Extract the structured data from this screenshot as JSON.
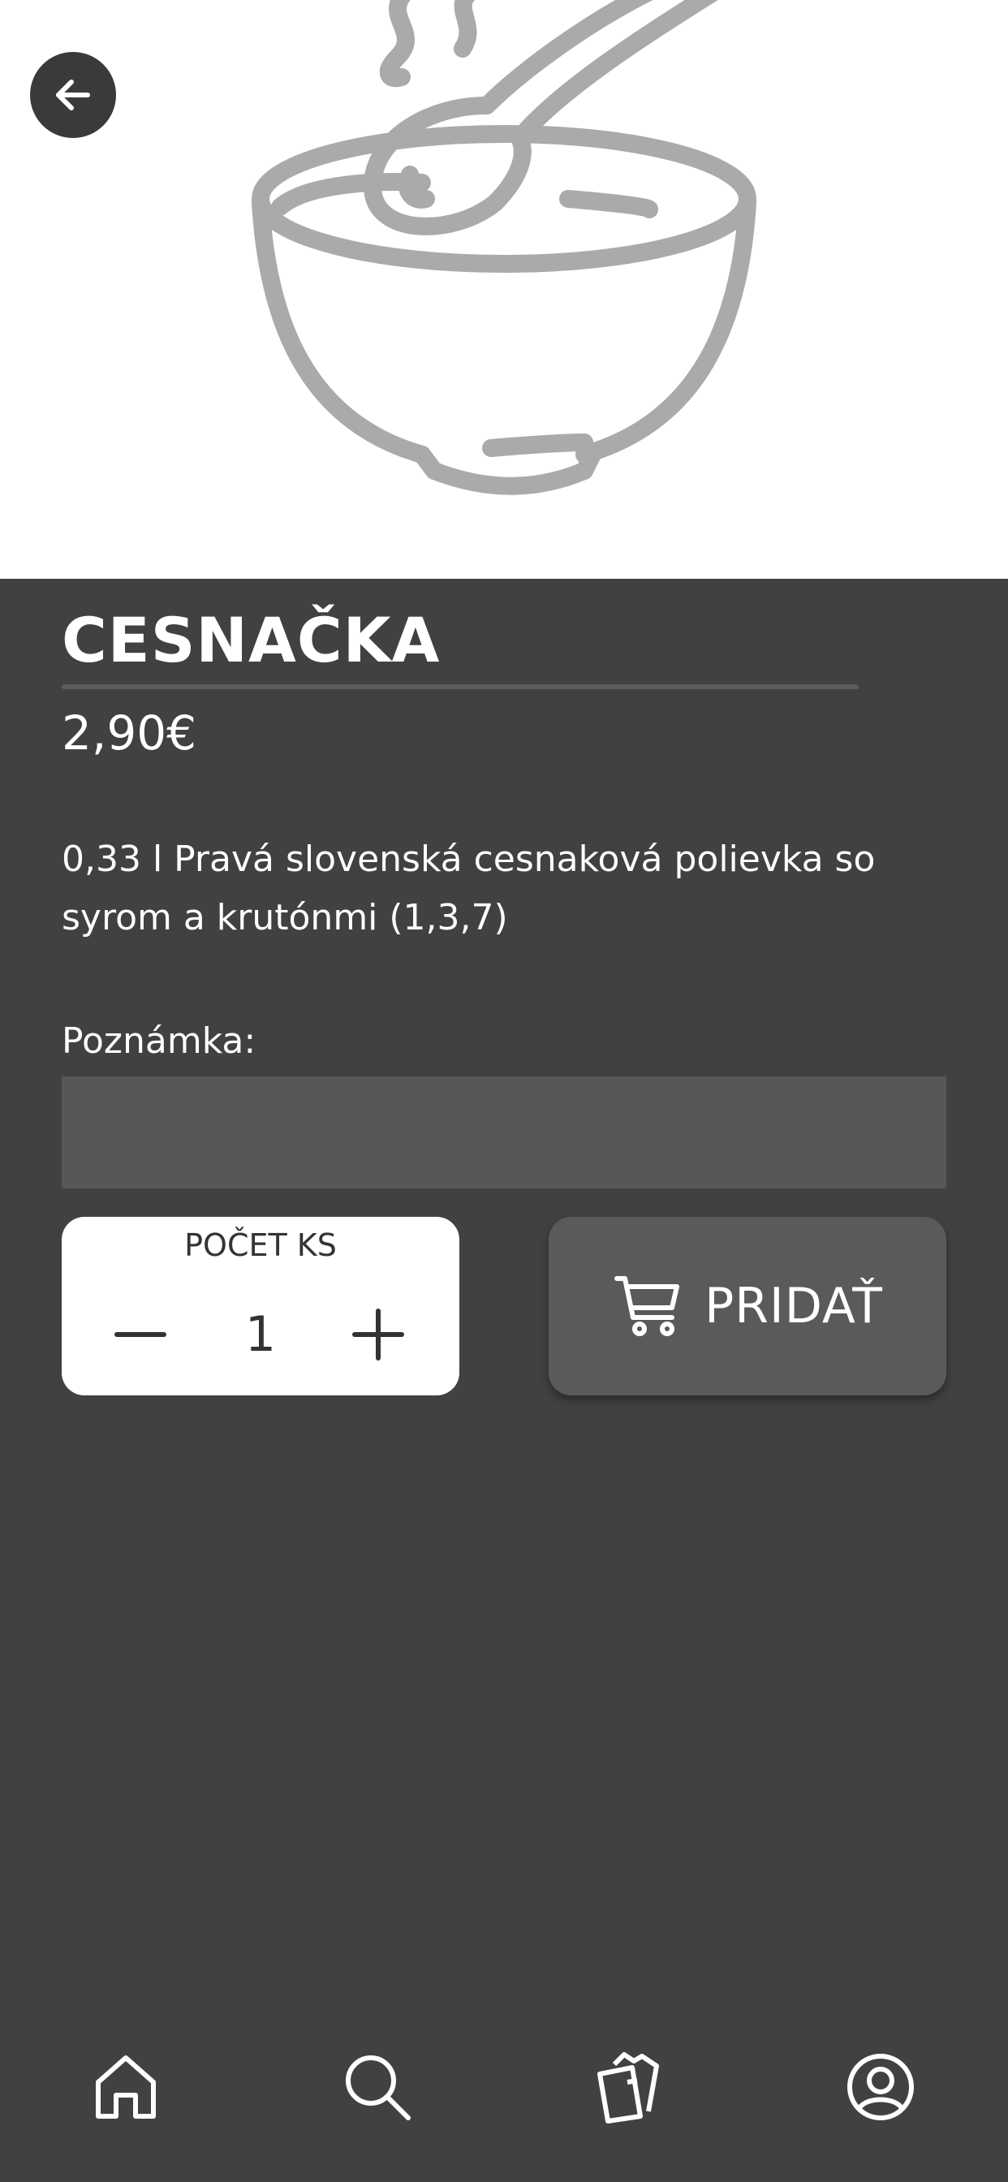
{
  "hero": {
    "image_icon": "soup-bowl-icon",
    "back_icon": "arrow-left-icon"
  },
  "product": {
    "name": "CESNAČKA",
    "price": "2,90€",
    "description": "0,33 l Pravá slovenská cesnaková polievka so syrom a krutónmi (1,3,7)"
  },
  "note": {
    "label": "Poznámka:",
    "value": "",
    "placeholder": ""
  },
  "quantity": {
    "label": "POČET KS",
    "value": "1",
    "minus_icon": "minus-icon",
    "plus_icon": "plus-icon"
  },
  "add_button": {
    "label": "PRIDAŤ",
    "icon": "cart-icon"
  },
  "bottom_nav": {
    "items": [
      {
        "icon": "home-icon"
      },
      {
        "icon": "search-icon"
      },
      {
        "icon": "menu-cards-icon"
      },
      {
        "icon": "user-icon"
      }
    ]
  },
  "colors": {
    "background": "#414141",
    "hero_background": "#ffffff",
    "illustration": "#aaaaaa",
    "input_background": "#575757",
    "button_background": "#5a5a5a",
    "text": "#ffffff",
    "qty_text": "#333333"
  }
}
